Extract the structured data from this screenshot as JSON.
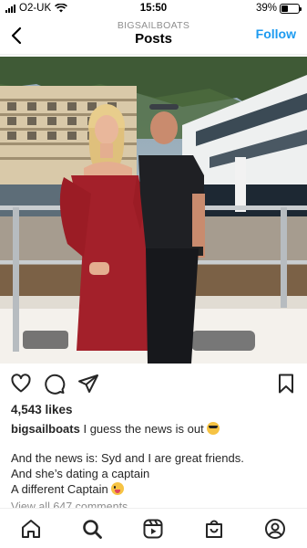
{
  "status_bar": {
    "carrier": "O2-UK",
    "time": "15:50",
    "battery_percent": "39%",
    "battery_level": 0.39
  },
  "header": {
    "subtitle": "BIGSAILBOATS",
    "title": "Posts",
    "follow_label": "Follow",
    "follow_color": "#1d9bf0"
  },
  "post": {
    "likes": "4,543 likes",
    "username": "bigsailboats",
    "caption_text": " I guess the news is out",
    "caption_emoji": "smiling-face-with-sunglasses",
    "body_lines": [
      "And the news is: Syd and I are great friends.",
      "And she’s dating a captain",
      "A different Captain"
    ],
    "body_emoji": "winking-face-with-tongue",
    "view_comments": "View all 647 comments"
  },
  "actions": {
    "icons": [
      "heart-icon",
      "comment-icon",
      "share-icon",
      "bookmark-icon"
    ]
  },
  "tabbar": {
    "icons": [
      "home-icon",
      "search-icon",
      "reels-icon",
      "shop-icon",
      "profile-icon"
    ]
  }
}
